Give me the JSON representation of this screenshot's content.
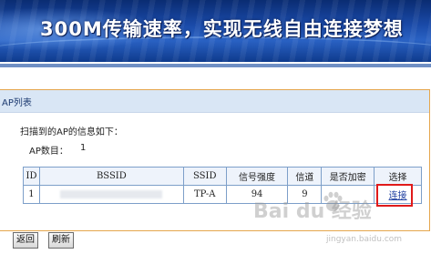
{
  "banner": {
    "text": "300M传输速率，实现无线自由连接梦想"
  },
  "panel": {
    "title": "AP列表",
    "info_text": "扫描到的AP的信息如下：",
    "ap_count_label": "AP数目：",
    "ap_count": "1"
  },
  "table": {
    "headers": [
      "ID",
      "BSSID",
      "SSID",
      "信号强度",
      "信道",
      "是否加密",
      "选择"
    ],
    "rows": [
      {
        "id": "1",
        "bssid": "",
        "ssid": "TP-A",
        "signal": "94",
        "channel": "9",
        "encrypted": "",
        "action": "连接"
      }
    ]
  },
  "buttons": {
    "back": "返回",
    "refresh": "刷新"
  },
  "watermark": {
    "text": "Bai du 经验",
    "url": "jingyan.baidu.com"
  },
  "colors": {
    "highlight": "#e01a1a",
    "link": "#1f3fa0",
    "table_border": "#7d9fc9",
    "panel_border": "#e5a64c"
  }
}
